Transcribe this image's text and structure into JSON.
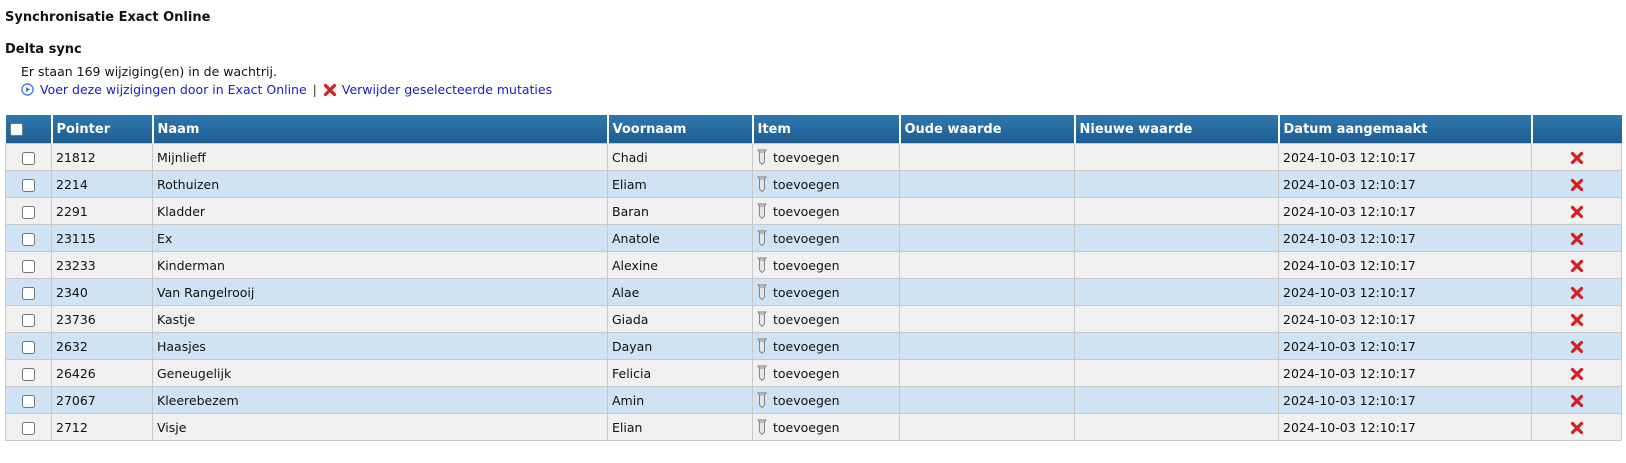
{
  "header": {
    "title": "Synchronisatie Exact Online",
    "subtitle": "Delta sync",
    "info": "Er staan 169 wijziging(en) in de wachtrij."
  },
  "actions": {
    "process_label": "Voer deze wijzigingen door in Exact Online",
    "separator": "|",
    "delete_label": "Verwijder geselecteerde mutaties"
  },
  "colors": {
    "header_bg": "#2f78b0",
    "row_alt": "#cfe3f5",
    "row": "#f0f0f0",
    "link": "#1a1ac8",
    "delete": "#d42020"
  },
  "table": {
    "columns": [
      "Pointer",
      "Naam",
      "Voornaam",
      "Item",
      "Oude waarde",
      "Nieuwe waarde",
      "Datum aangemaakt"
    ],
    "rows": [
      {
        "pointer": "21812",
        "naam": "Mijnlieff",
        "voornaam": "Chadi",
        "item": "toevoegen",
        "oud": "",
        "nieuw": "",
        "datum": "2024-10-03 12:10:17"
      },
      {
        "pointer": "2214",
        "naam": "Rothuizen",
        "voornaam": "Eliam",
        "item": "toevoegen",
        "oud": "",
        "nieuw": "",
        "datum": "2024-10-03 12:10:17"
      },
      {
        "pointer": "2291",
        "naam": "Kladder",
        "voornaam": "Baran",
        "item": "toevoegen",
        "oud": "",
        "nieuw": "",
        "datum": "2024-10-03 12:10:17"
      },
      {
        "pointer": "23115",
        "naam": "Ex",
        "voornaam": "Anatole",
        "item": "toevoegen",
        "oud": "",
        "nieuw": "",
        "datum": "2024-10-03 12:10:17"
      },
      {
        "pointer": "23233",
        "naam": "Kinderman",
        "voornaam": "Alexine",
        "item": "toevoegen",
        "oud": "",
        "nieuw": "",
        "datum": "2024-10-03 12:10:17"
      },
      {
        "pointer": "2340",
        "naam": "Van Rangelrooij",
        "voornaam": "Alae",
        "item": "toevoegen",
        "oud": "",
        "nieuw": "",
        "datum": "2024-10-03 12:10:17"
      },
      {
        "pointer": "23736",
        "naam": "Kastje",
        "voornaam": "Giada",
        "item": "toevoegen",
        "oud": "",
        "nieuw": "",
        "datum": "2024-10-03 12:10:17"
      },
      {
        "pointer": "2632",
        "naam": "Haasjes",
        "voornaam": "Dayan",
        "item": "toevoegen",
        "oud": "",
        "nieuw": "",
        "datum": "2024-10-03 12:10:17"
      },
      {
        "pointer": "26426",
        "naam": "Geneugelijk",
        "voornaam": "Felicia",
        "item": "toevoegen",
        "oud": "",
        "nieuw": "",
        "datum": "2024-10-03 12:10:17"
      },
      {
        "pointer": "27067",
        "naam": "Kleerebezem",
        "voornaam": "Amin",
        "item": "toevoegen",
        "oud": "",
        "nieuw": "",
        "datum": "2024-10-03 12:10:17"
      },
      {
        "pointer": "2712",
        "naam": "Visje",
        "voornaam": "Elian",
        "item": "toevoegen",
        "oud": "",
        "nieuw": "",
        "datum": "2024-10-03 12:10:17"
      }
    ]
  }
}
